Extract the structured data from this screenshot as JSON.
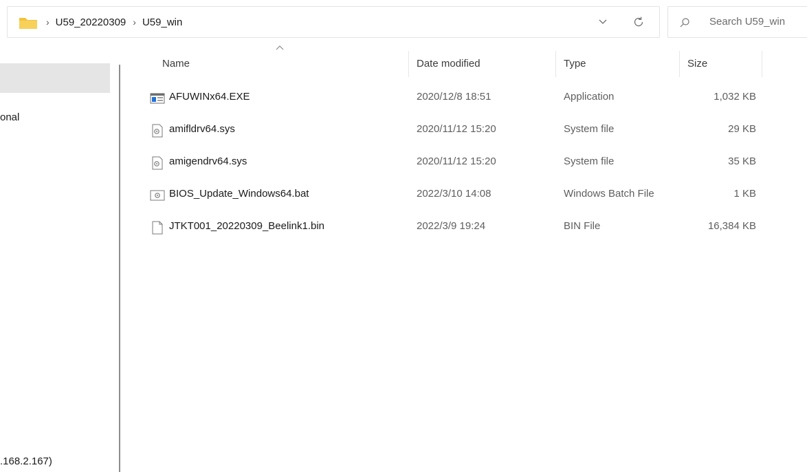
{
  "address": {
    "breadcrumbs": [
      "U59_20220309",
      "U59_win"
    ],
    "folder_icon": "folder-icon",
    "dropdown_icon": "chevron-down-icon",
    "refresh_icon": "refresh-icon"
  },
  "search": {
    "placeholder": "Search U59_win",
    "icon": "search-icon"
  },
  "nav": {
    "items": [
      {
        "label": "",
        "selected": true
      },
      {
        "label": "onal"
      },
      {
        "label": ".168.2.167)"
      }
    ]
  },
  "columns": {
    "name": "Name",
    "date": "Date modified",
    "type": "Type",
    "size": "Size",
    "sort_indicator": "chevron-up-icon"
  },
  "files": [
    {
      "name": "AFUWINx64.EXE",
      "date": "2020/12/8 18:51",
      "type": "Application",
      "size": "1,032 KB",
      "icon": "application-icon"
    },
    {
      "name": "amifldrv64.sys",
      "date": "2020/11/12 15:20",
      "type": "System file",
      "size": "29 KB",
      "icon": "system-file-icon"
    },
    {
      "name": "amigendrv64.sys",
      "date": "2020/11/12 15:20",
      "type": "System file",
      "size": "35 KB",
      "icon": "system-file-icon"
    },
    {
      "name": "BIOS_Update_Windows64.bat",
      "date": "2022/3/10 14:08",
      "type": "Windows Batch File",
      "size": "1 KB",
      "icon": "batch-file-icon"
    },
    {
      "name": "JTKT001_20220309_Beelink1.bin",
      "date": "2022/3/9 19:24",
      "type": "BIN File",
      "size": "16,384 KB",
      "icon": "generic-file-icon"
    }
  ],
  "colors": {
    "folder": "#f3c33a",
    "selection": "#e5e5e5",
    "divider": "#8c8c8c"
  }
}
